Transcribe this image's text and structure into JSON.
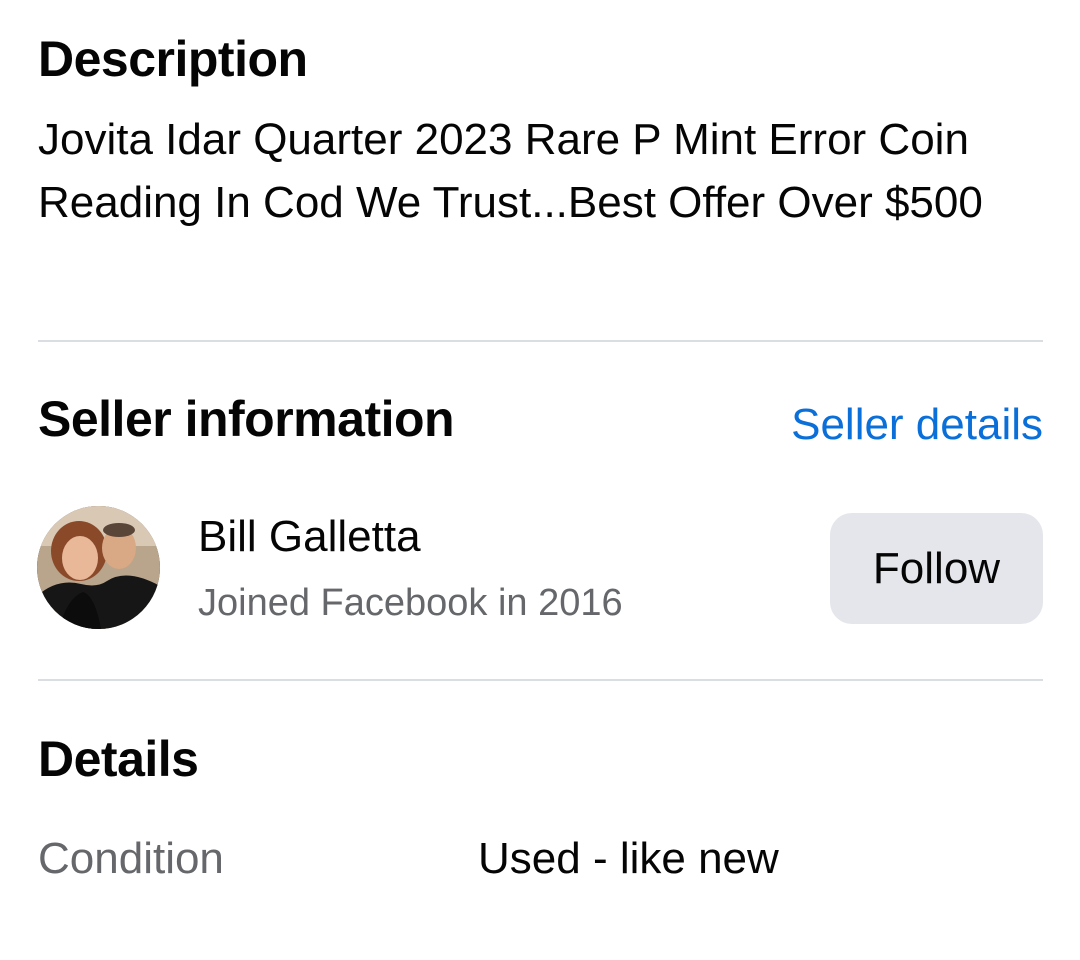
{
  "description": {
    "title": "Description",
    "text": "Jovita Idar Quarter 2023 Rare P Mint Error Coin Reading In Cod We Trust...Best Offer Over $500"
  },
  "seller": {
    "title": "Seller information",
    "details_link": "Seller details",
    "name": "Bill Galletta",
    "joined": "Joined Facebook in 2016",
    "follow_label": "Follow",
    "avatar": "seller-profile-photo"
  },
  "details": {
    "title": "Details",
    "rows": [
      {
        "label": "Condition",
        "value": "Used - like new"
      }
    ]
  },
  "colors": {
    "link": "#0a6fd8",
    "secondary_text": "#65676b",
    "button_bg": "#e4e6eb",
    "divider": "#dadde1"
  }
}
